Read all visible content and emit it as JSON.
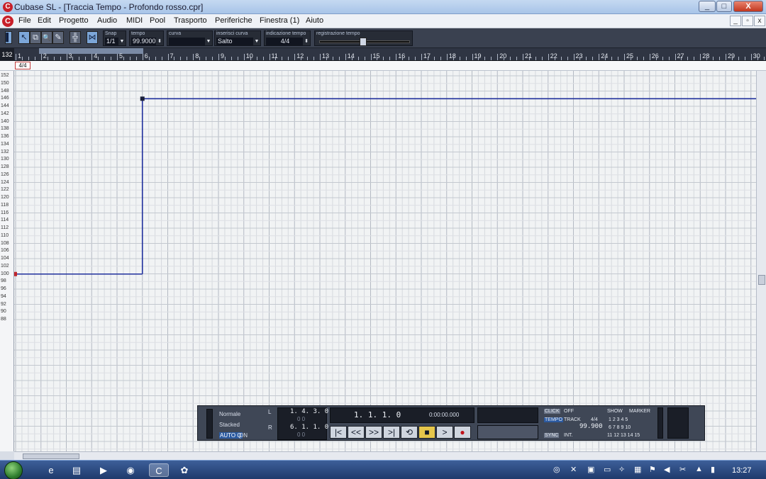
{
  "window": {
    "title": "Cubase SL - [Traccia Tempo - Profondo rosso.cpr]",
    "minimize": "_",
    "maximize": "□",
    "close": "X"
  },
  "menu": {
    "items": [
      "File",
      "Edit",
      "Progetto",
      "Audio",
      "MIDI",
      "Pool",
      "Trasporto",
      "Periferiche",
      "Finestra (1)",
      "Aiuto"
    ],
    "doc_buttons": [
      "_",
      "▫",
      "x"
    ]
  },
  "toolbar": {
    "snap": {
      "label": "Snap",
      "value": "1/1"
    },
    "tempo": {
      "label": "tempo",
      "value": "99.9000"
    },
    "curve": {
      "label": "curva",
      "value": ""
    },
    "insert_curve": {
      "label": "inserisci curva",
      "value": "Salto"
    },
    "signature": {
      "label": "indicazione tempo",
      "value": "4/4"
    },
    "tempo_record": {
      "label": "registrazione tempo"
    },
    "tools": [
      "▌",
      "↖",
      "⧉",
      "🔍",
      "✎"
    ]
  },
  "ruler": {
    "corner": "132",
    "bars": [
      "1",
      "2",
      "3",
      "4",
      "5",
      "6",
      "7",
      "8",
      "9",
      "10",
      "11",
      "12",
      "13",
      "14",
      "15",
      "16",
      "17",
      "18",
      "19",
      "20",
      "21",
      "22",
      "23",
      "24",
      "25",
      "26",
      "27",
      "28",
      "29",
      "30"
    ]
  },
  "signature_lane": {
    "marker": "4/4"
  },
  "tempo_axis": {
    "labels": [
      "152",
      "150",
      "148",
      "146",
      "144",
      "142",
      "140",
      "138",
      "136",
      "134",
      "132",
      "130",
      "128",
      "126",
      "124",
      "122",
      "120",
      "118",
      "116",
      "114",
      "112",
      "110",
      "108",
      "106",
      "104",
      "102",
      "100",
      "98",
      "96",
      "94",
      "92",
      "90",
      "88"
    ]
  },
  "tempo_track": {
    "bars_per_grid": 1,
    "points": [
      {
        "bar": 1,
        "bpm": 100
      },
      {
        "bar": 6,
        "bpm": 100
      },
      {
        "bar": 6,
        "bpm": 146
      },
      {
        "bar": 30,
        "bpm": 146
      }
    ]
  },
  "transport": {
    "mode_normal": "Normale",
    "mode_stacked": "Stacked",
    "auto": "AUTO Q",
    "auto_state": "ON",
    "left_locator": "1. 4. 3.   0",
    "left_sub": "0     0",
    "right_locator": "6. 1. 1.   0",
    "right_sub": "0     0",
    "position": "1.  1.  1.    0",
    "time": "0:00:00.000",
    "click_label": "CLICK",
    "click_state": "OFF",
    "tempo_label": "TEMPO",
    "track_label": "TRACK",
    "signature": "4/4",
    "tempo_value": "99.900",
    "sync_label": "SYNC",
    "sync_state": "INT.",
    "show_label": "SHOW",
    "marker_label": "MARKER",
    "markers_row1": "1  2  3  4  5",
    "markers_row2": "6  7  8  9  10",
    "markers_row3": "11 12 13 14 15",
    "buttons": [
      "|<",
      "<<",
      ">>",
      ">|",
      "⟲",
      "■",
      ">",
      "●"
    ]
  },
  "taskbar": {
    "clock": "13:27"
  }
}
